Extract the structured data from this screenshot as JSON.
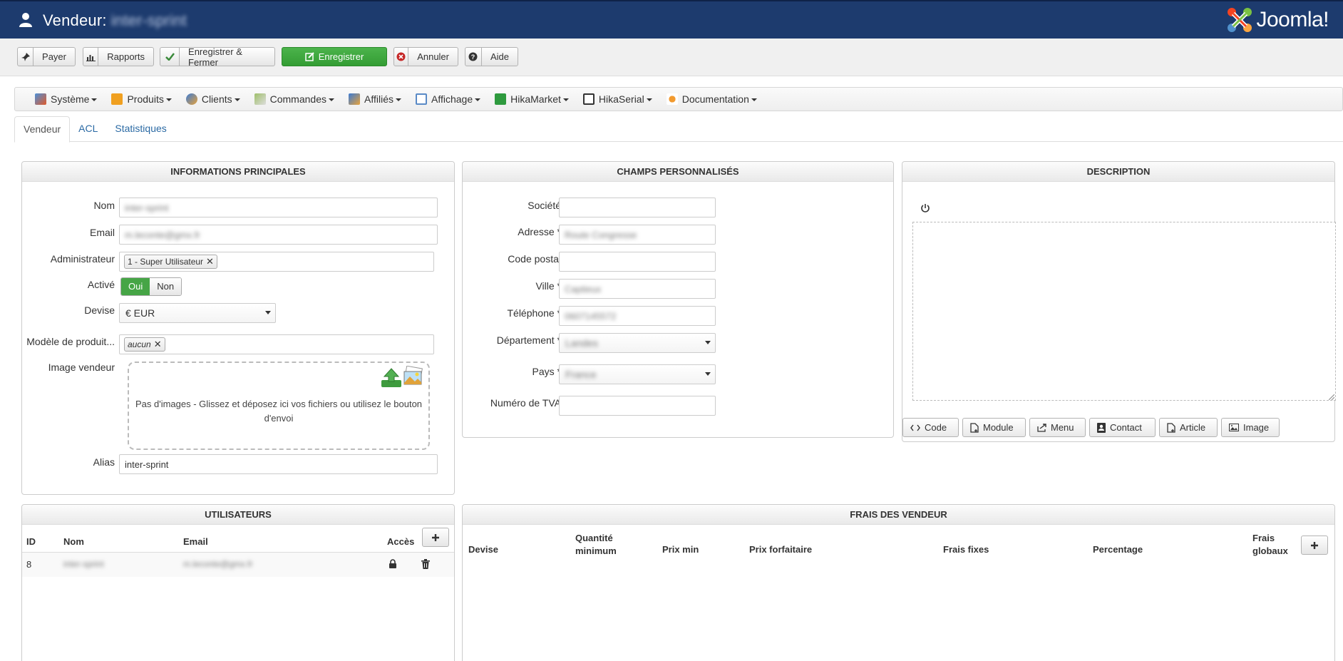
{
  "header": {
    "title": "Vendeur:",
    "vendor_name": "inter-sprint",
    "logo_text": "Joomla!"
  },
  "toolbar": {
    "pay": "Payer",
    "reports": "Rapports",
    "save_close": "Enregistrer & Fermer",
    "save": "Enregistrer",
    "cancel": "Annuler",
    "help": "Aide"
  },
  "menu": {
    "items": [
      "Système",
      "Produits",
      "Clients",
      "Commandes",
      "Affiliés",
      "Affichage",
      "HikaMarket",
      "HikaSerial",
      "Documentation"
    ]
  },
  "tabs": {
    "items": [
      "Vendeur",
      "ACL",
      "Statistiques"
    ]
  },
  "main_info": {
    "title": "INFORMATIONS PRINCIPALES",
    "name_label": "Nom",
    "name_value": "inter-sprint",
    "email_label": "Email",
    "email_value": "m.leconte@gmx.fr",
    "admin_label": "Administrateur",
    "admin_value": "1 - Super Utilisateur",
    "active_label": "Activé",
    "active_yes": "Oui",
    "active_no": "Non",
    "currency_label": "Devise",
    "currency_value": "€ EUR",
    "template_label": "Modèle de produit...",
    "template_value": "aucun",
    "image_label": "Image vendeur",
    "dropzone_text": "Pas d'images - Glissez et déposez ici vos fichiers ou utilisez le bouton d'envoi",
    "alias_label": "Alias",
    "alias_value": "inter-sprint"
  },
  "custom_fields": {
    "title": "CHAMPS PERSONNALISÉS",
    "company_label": "Société",
    "company_value": "",
    "address_label": "Adresse *",
    "address_value": "Route Congresse",
    "zip_label": "Code postal",
    "zip_value": "",
    "city_label": "Ville *",
    "city_value": "Captieux",
    "phone_label": "Téléphone *",
    "phone_value": "0607145572",
    "dept_label": "Département *",
    "dept_value": "Landes",
    "country_label": "Pays *",
    "country_value": "France",
    "vat_label": "Numéro de TVA",
    "vat_value": ""
  },
  "description": {
    "title": "DESCRIPTION",
    "buttons": [
      "Code",
      "Module",
      "Menu",
      "Contact",
      "Article",
      "Image"
    ]
  },
  "users": {
    "title": "UTILISATEURS",
    "headers": [
      "ID",
      "Nom",
      "Email",
      "Accès"
    ],
    "rows": [
      {
        "id": "8",
        "name": "inter-sprint",
        "email": "m.leconte@gmx.fr"
      }
    ]
  },
  "fees": {
    "title": "FRAIS DES VENDEUR",
    "headers": [
      "Devise",
      "Quantité minimum",
      "Prix min",
      "Prix forfaitaire",
      "Frais fixes",
      "Percentage",
      "Frais globaux"
    ]
  },
  "colors": {
    "header_bg": "#1d3b6e",
    "save_green": "#46a546",
    "link_blue": "#2b6aa4"
  }
}
